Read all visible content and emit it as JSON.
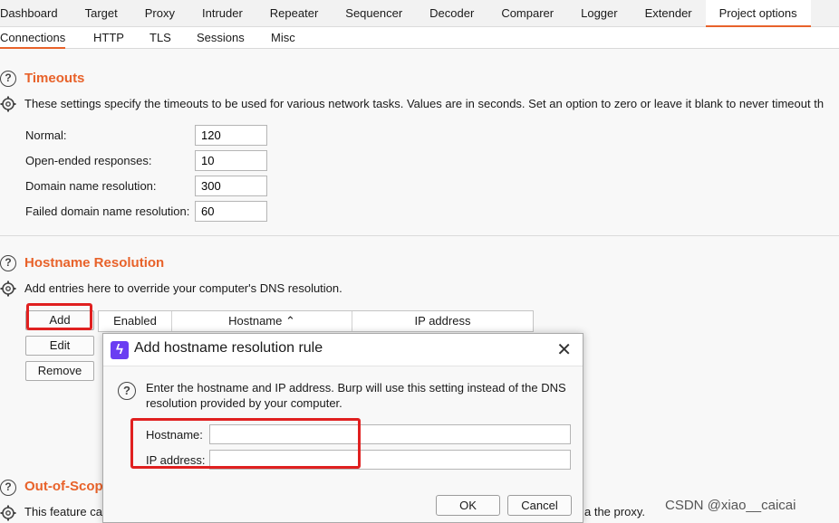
{
  "main_tabs": [
    "Dashboard",
    "Target",
    "Proxy",
    "Intruder",
    "Repeater",
    "Sequencer",
    "Decoder",
    "Comparer",
    "Logger",
    "Extender",
    "Project options"
  ],
  "main_tab_active": "Project options",
  "sub_tabs": [
    "Connections",
    "HTTP",
    "TLS",
    "Sessions",
    "Misc"
  ],
  "sub_tab_active": "Connections",
  "timeouts": {
    "title": "Timeouts",
    "description": "These settings specify the timeouts to be used for various network tasks. Values are in seconds. Set an option to zero or leave it blank to never timeout th",
    "fields": [
      {
        "label": "Normal:",
        "value": "120"
      },
      {
        "label": "Open-ended responses:",
        "value": "10"
      },
      {
        "label": "Domain name resolution:",
        "value": "300"
      },
      {
        "label": "Failed domain name resolution:",
        "value": "60"
      }
    ]
  },
  "hostname": {
    "title": "Hostname Resolution",
    "description": "Add entries here to override your computer's DNS resolution.",
    "buttons": {
      "add": "Add",
      "edit": "Edit",
      "remove": "Remove"
    },
    "columns": [
      "Enabled",
      "Hostname ⌃",
      "IP address"
    ]
  },
  "out_of_scope": {
    "title": "Out-of-Scop",
    "description_left": "This feature ca",
    "description_right": "a the proxy."
  },
  "dialog": {
    "title": "Add hostname resolution rule",
    "help_line1": "Enter the hostname and IP address. Burp will use this setting instead of the DNS",
    "help_line2": "resolution provided by your computer.",
    "hostname_label": "Hostname:",
    "hostname_value": "",
    "ip_label": "IP address:",
    "ip_value": "",
    "ok": "OK",
    "cancel": "Cancel"
  },
  "watermark": "CSDN @xiao__caicai",
  "colors": {
    "accent": "#e8622a",
    "highlight": "#e02020",
    "logo": "#6a3df2"
  }
}
